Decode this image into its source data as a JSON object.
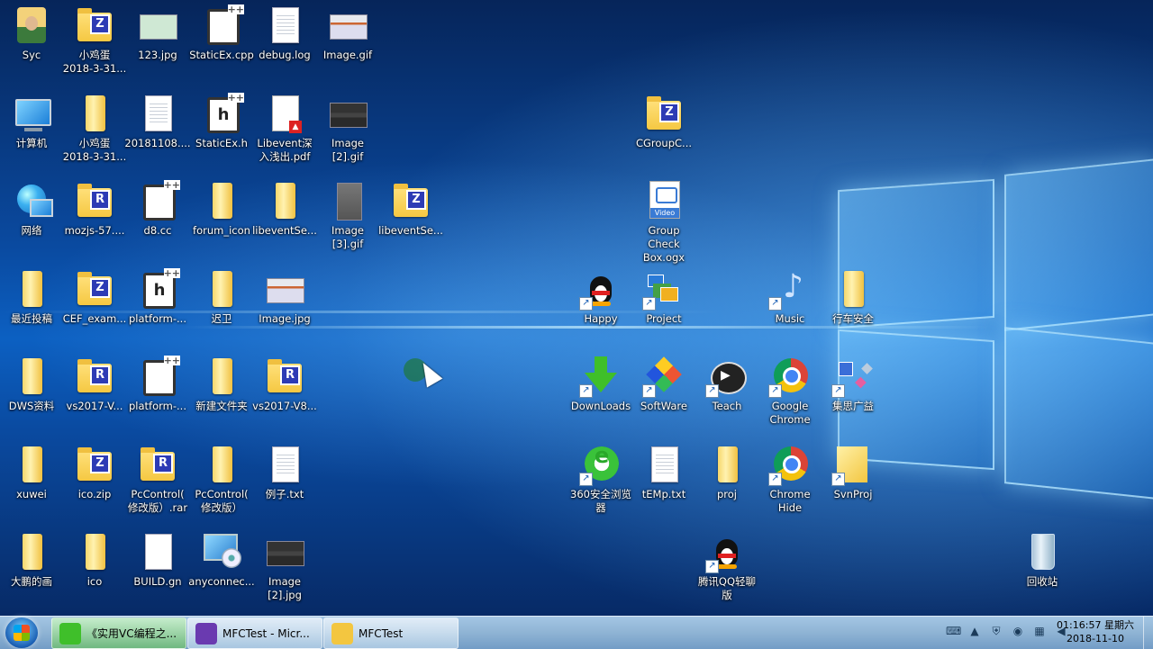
{
  "desktop": {
    "icons": [
      {
        "label": "Syc",
        "kind": "person"
      },
      {
        "label": "小鸡蛋\n2018-3-31...",
        "kind": "folder-z"
      },
      {
        "label": "123.jpg",
        "kind": "img-green"
      },
      {
        "label": "StaticEx.cpp",
        "kind": "code",
        "glyph": ""
      },
      {
        "label": "debug.log",
        "kind": "doc"
      },
      {
        "label": "Image.gif",
        "kind": "img"
      },
      {
        "label": "计算机",
        "kind": "pc"
      },
      {
        "label": "小鸡蛋\n2018-3-31...",
        "kind": "folder-tall"
      },
      {
        "label": "20181108....",
        "kind": "doc"
      },
      {
        "label": "StaticEx.h",
        "kind": "code",
        "glyph": "h"
      },
      {
        "label": "Libevent深\n入浅出.pdf",
        "kind": "pdf"
      },
      {
        "label": "Image\n[2].gif",
        "kind": "img-dark"
      },
      {
        "label": "CGroupC...",
        "kind": "folder-z"
      },
      {
        "label": "网络",
        "kind": "globe"
      },
      {
        "label": "mozjs-57....",
        "kind": "folder-r"
      },
      {
        "label": "d8.cc",
        "kind": "code",
        "glyph": ""
      },
      {
        "label": "forum_icon",
        "kind": "folder-tall"
      },
      {
        "label": "libeventSe...",
        "kind": "folder-tall"
      },
      {
        "label": "Image\n[3].gif",
        "kind": "img-gray"
      },
      {
        "label": "libeventSe...",
        "kind": "folder-z"
      },
      {
        "label": "Group\nCheck\nBox.ogx",
        "kind": "video"
      },
      {
        "label": "最近投稿",
        "kind": "folder-tall"
      },
      {
        "label": "CEF_exam...",
        "kind": "folder-z"
      },
      {
        "label": "platform-...",
        "kind": "code",
        "glyph": "h"
      },
      {
        "label": "迟卫",
        "kind": "folder-tall"
      },
      {
        "label": "Image.jpg",
        "kind": "img"
      },
      {
        "label": "Happy",
        "kind": "qq",
        "shortcut": true
      },
      {
        "label": "Project",
        "kind": "project",
        "shortcut": true
      },
      {
        "label": "Music",
        "kind": "note",
        "shortcut": true
      },
      {
        "label": "行车安全",
        "kind": "folder-tall"
      },
      {
        "label": "DWS资料",
        "kind": "folder-tall"
      },
      {
        "label": "vs2017-V...",
        "kind": "folder-r"
      },
      {
        "label": "platform-...",
        "kind": "code",
        "glyph": ""
      },
      {
        "label": "新建文件夹",
        "kind": "folder-tall"
      },
      {
        "label": "vs2017-V8...",
        "kind": "folder-r"
      },
      {
        "label": "DownLoads",
        "kind": "download",
        "shortcut": true
      },
      {
        "label": "SoftWare",
        "kind": "diamond",
        "shortcut": true
      },
      {
        "label": "Teach",
        "kind": "cam",
        "shortcut": true
      },
      {
        "label": "Google\nChrome",
        "kind": "chrome",
        "shortcut": true
      },
      {
        "label": "集思广益",
        "kind": "gear",
        "shortcut": true
      },
      {
        "label": "xuwei",
        "kind": "folder-tall"
      },
      {
        "label": "ico.zip",
        "kind": "folder-z"
      },
      {
        "label": "PcControl(\n修改版）.rar",
        "kind": "folder-r"
      },
      {
        "label": "PcControl(\n修改版）",
        "kind": "folder-tall"
      },
      {
        "label": "例子.txt",
        "kind": "doc"
      },
      {
        "label": "360安全浏览\n器",
        "kind": "e360",
        "shortcut": true
      },
      {
        "label": "tEMp.txt",
        "kind": "doc"
      },
      {
        "label": "proj",
        "kind": "folder-tall"
      },
      {
        "label": "Chrome\nHide",
        "kind": "chrome",
        "shortcut": true
      },
      {
        "label": "SvnProj",
        "kind": "bigfolder",
        "shortcut": true
      },
      {
        "label": "大鹏的画",
        "kind": "folder-tall"
      },
      {
        "label": "ico",
        "kind": "folder-tall"
      },
      {
        "label": "BUILD.gn",
        "kind": "doc-plain"
      },
      {
        "label": "anyconnec...",
        "kind": "cd"
      },
      {
        "label": "Image\n[2].jpg",
        "kind": "img-dark"
      },
      {
        "label": "腾讯QQ轻聊\n版",
        "kind": "qq",
        "shortcut": true
      },
      {
        "label": "回收站",
        "kind": "bin"
      }
    ]
  },
  "taskbar": {
    "tasks": [
      {
        "label": "《实用VC编程之...",
        "icon_color": "#3fbf2a",
        "active": true
      },
      {
        "label": "MFCTest - Micr...",
        "icon_color": "#6a3ab0",
        "active": false
      },
      {
        "label": "MFCTest",
        "icon_color": "#f3c640",
        "active": false
      }
    ],
    "tray_icons": [
      "keyboard-icon",
      "chevron-up-icon",
      "shield-icon",
      "antivirus-icon",
      "network-icon",
      "volume-icon"
    ],
    "clock": {
      "time": "01:16:57 星期六",
      "date": "2018-11-10"
    }
  }
}
